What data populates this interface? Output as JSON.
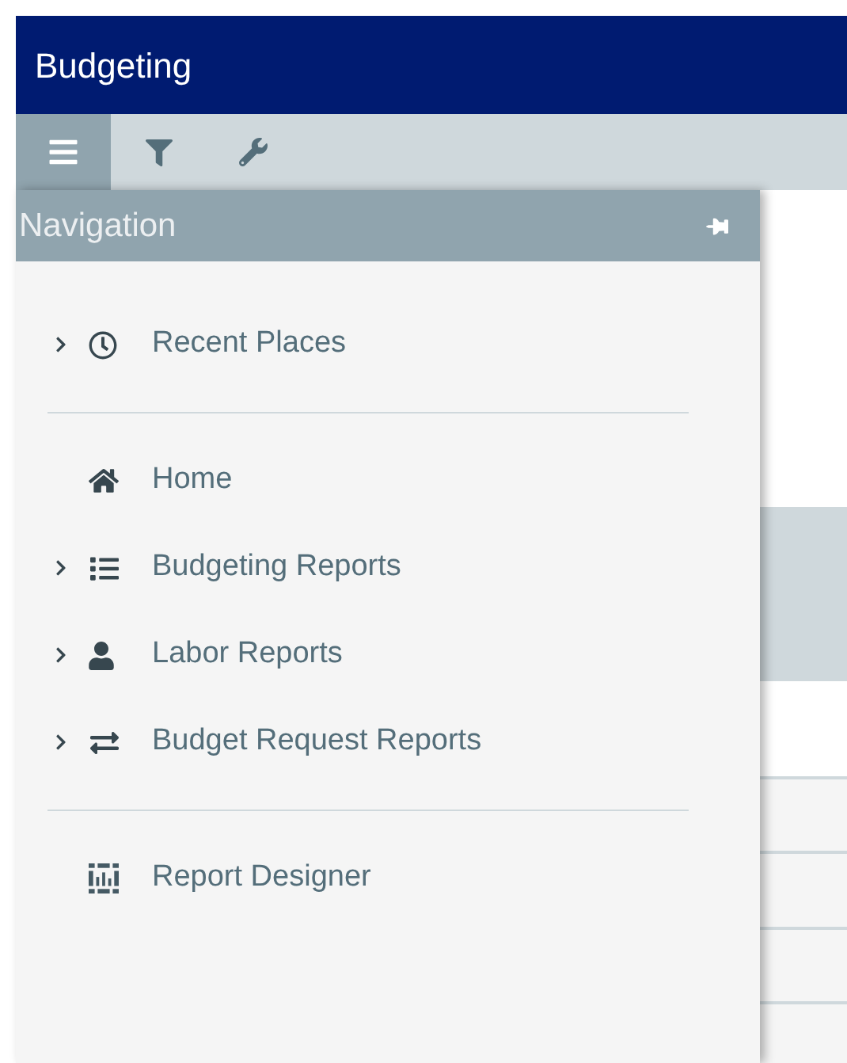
{
  "window": {
    "title": "Budgeting"
  },
  "toolbar": [
    {
      "selected": true
    },
    {
      "selected": false
    },
    {
      "selected": false
    }
  ],
  "navigation": {
    "title": "Navigation",
    "sections": [
      [
        {
          "label": "Recent Places",
          "expandable": true
        }
      ],
      [
        {
          "label": "Home",
          "expandable": false
        },
        {
          "label": "Budgeting Reports",
          "expandable": true
        },
        {
          "label": "Labor Reports",
          "expandable": true
        },
        {
          "label": "Budget Request Reports",
          "expandable": true
        }
      ],
      [
        {
          "label": "Report Designer",
          "expandable": false
        }
      ]
    ]
  }
}
